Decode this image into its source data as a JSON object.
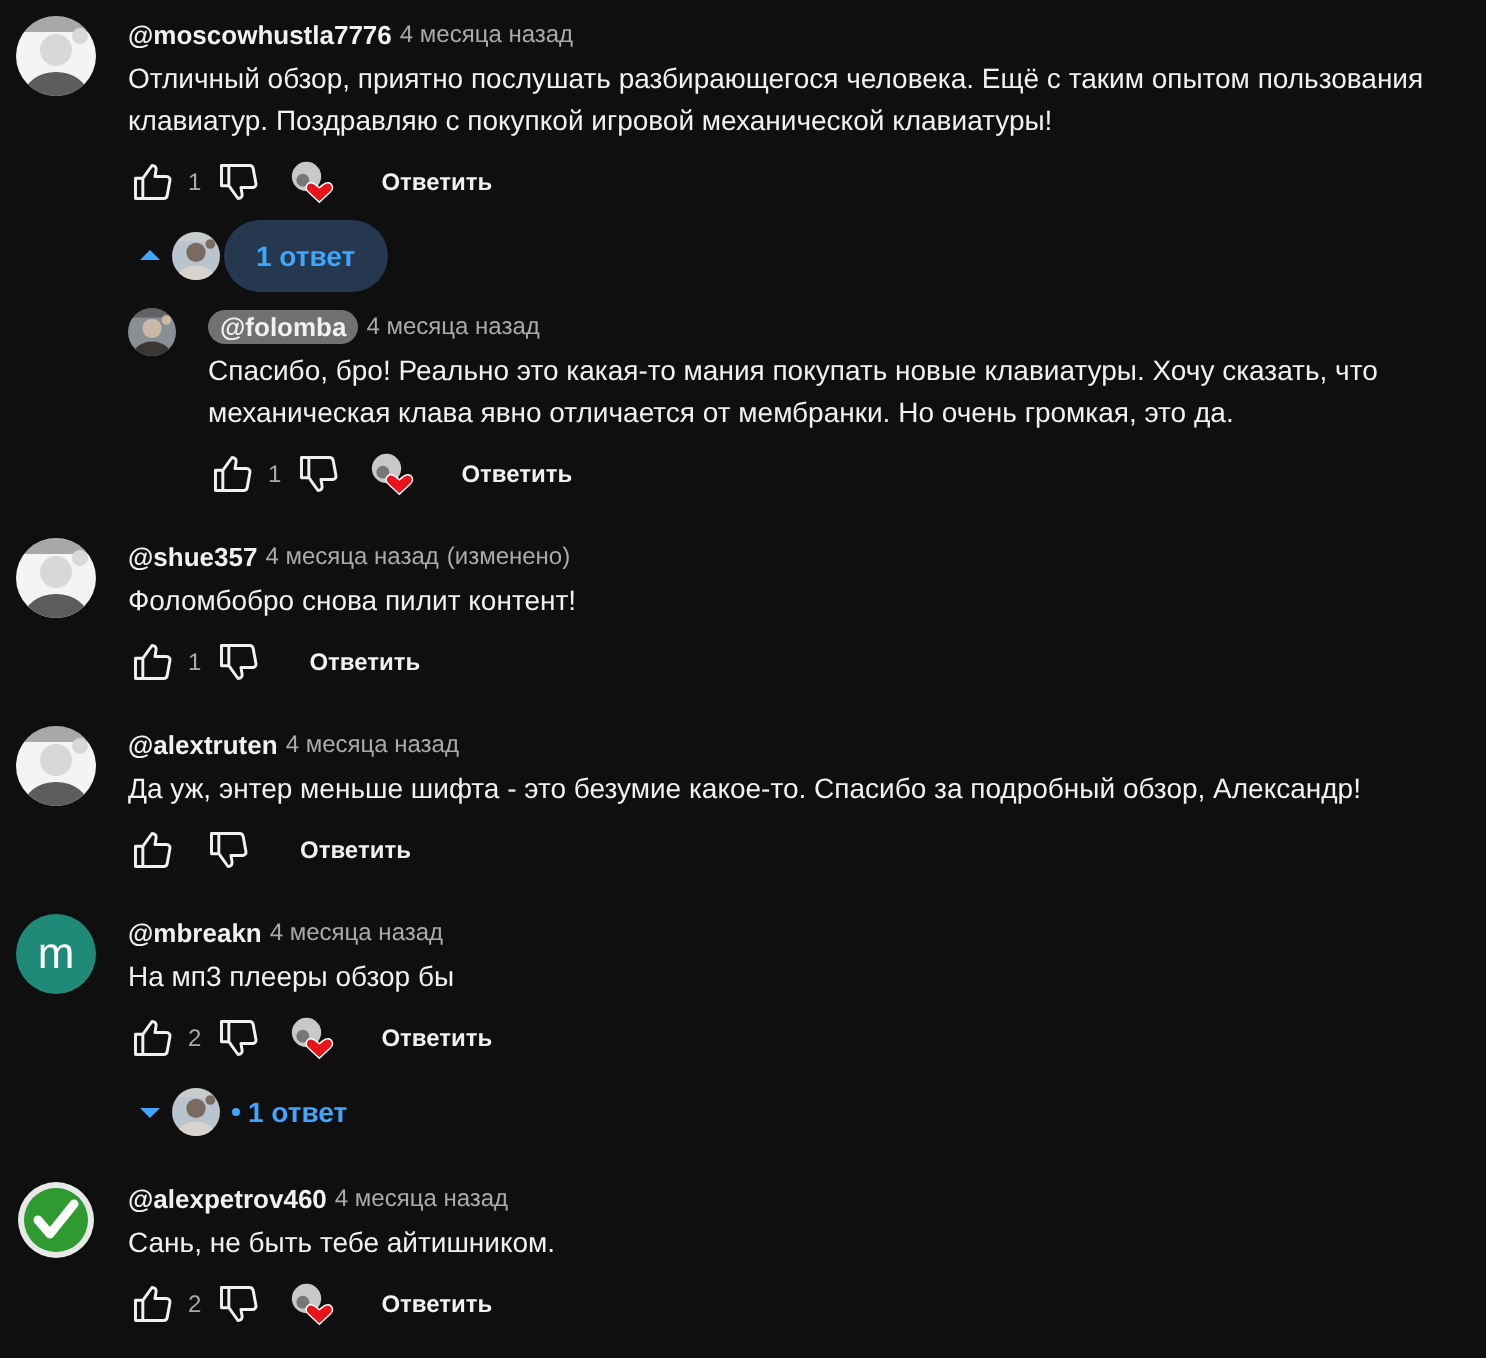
{
  "comments": [
    {
      "author": "@moscowhustla7776",
      "author_highlighted": false,
      "time": "4 месяца назад",
      "text": "Отличный обзор, приятно послушать разбирающегося человека. Ещё с таким опытом пользования клавиатур. Поздравляю с покупкой игровой механической клавиатуры!",
      "likes": "1",
      "hearted": true,
      "reply_label": "Ответить",
      "replies_toggle": {
        "expanded": true,
        "label": "1 ответ"
      },
      "replies": [
        {
          "author": "@folomba",
          "author_highlighted": true,
          "time": "4 месяца назад",
          "text": "Спасибо, бро! Реально это какая-то мания покупать новые клавиатуры. Хочу сказать, что механическая клава явно отличается от мембранки. Но очень громкая, это да.",
          "likes": "1",
          "hearted": true,
          "reply_label": "Ответить"
        }
      ]
    },
    {
      "author": "@shue357",
      "author_highlighted": false,
      "time": "4 месяца назад",
      "edited": "(изменено)",
      "text": "Фоломбобро снова пилит контент!",
      "likes": "1",
      "hearted": false,
      "reply_label": "Ответить"
    },
    {
      "author": "@alextruten",
      "author_highlighted": false,
      "time": "4 месяца назад",
      "text": "Да уж, энтер меньше шифта - это безумие какое-то. Спасибо за подробный обзор, Александр!",
      "hearted": false,
      "reply_label": "Ответить"
    },
    {
      "avatar": {
        "kind": "letter",
        "letter": "m",
        "color": "#1e8a77"
      },
      "author": "@mbreakn",
      "author_highlighted": false,
      "time": "4 месяца назад",
      "text": "На мп3 плееры обзор бы",
      "likes": "2",
      "hearted": true,
      "reply_label": "Ответить",
      "replies_toggle": {
        "expanded": false,
        "label": "1 ответ"
      }
    },
    {
      "avatar": {
        "kind": "check"
      },
      "author": "@alexpetrov460",
      "author_highlighted": false,
      "time": "4 месяца назад",
      "text": "Сань, не быть тебе айтишником.",
      "likes": "2",
      "hearted": true,
      "reply_label": "Ответить"
    }
  ]
}
